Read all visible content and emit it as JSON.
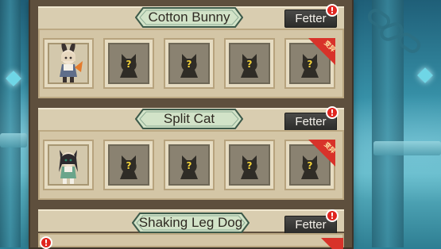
{
  "colors": {
    "panel": "#5e4f3d",
    "section_body": "#d4c6a6",
    "title_plate_fill": "#d2e3c8",
    "title_plate_border": "#3d5a4a",
    "fetter_button": "#2c2c2a",
    "badge": "#e0251f",
    "question_mark": "#f2d23a",
    "variant_ribbon": "#d8322a"
  },
  "sections": [
    {
      "title": "Cotton Bunny",
      "fetter_label": "Fetter",
      "badge": "!",
      "slots": [
        {
          "state": "owned",
          "icon": "bunny-girl-character-icon"
        },
        {
          "state": "locked",
          "label": "?",
          "icon": "locked-silhouette-icon"
        },
        {
          "state": "locked",
          "label": "?",
          "icon": "locked-silhouette-icon"
        },
        {
          "state": "locked",
          "label": "?",
          "icon": "locked-silhouette-icon"
        },
        {
          "state": "locked",
          "label": "?",
          "icon": "locked-silhouette-icon",
          "ribbon": "变异"
        }
      ]
    },
    {
      "title": "Split Cat",
      "fetter_label": "Fetter",
      "badge": "!",
      "slots": [
        {
          "state": "owned",
          "icon": "cat-girl-character-icon"
        },
        {
          "state": "locked",
          "label": "?",
          "icon": "locked-silhouette-icon"
        },
        {
          "state": "locked",
          "label": "?",
          "icon": "locked-silhouette-icon"
        },
        {
          "state": "locked",
          "label": "?",
          "icon": "locked-silhouette-icon"
        },
        {
          "state": "locked",
          "label": "?",
          "icon": "locked-silhouette-icon",
          "ribbon": "变异"
        }
      ]
    },
    {
      "title": "Shaking Leg Dog",
      "fetter_label": "Fetter",
      "badge": "!",
      "slot_badge": "!"
    }
  ]
}
